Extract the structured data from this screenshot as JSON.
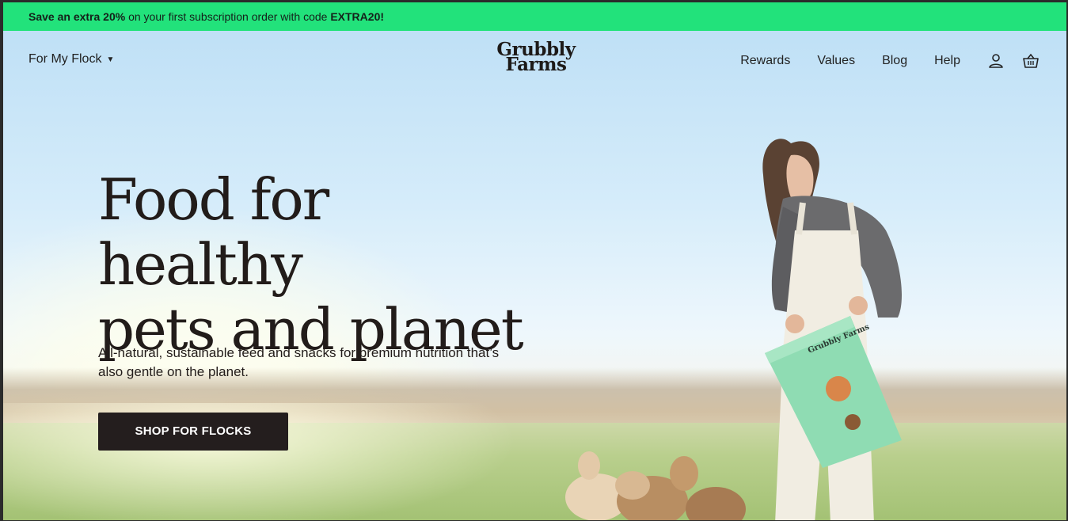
{
  "promo": {
    "prefix_bold": "Save an extra 20%",
    "middle": " on your first subscription order with code ",
    "code": "EXTRA20!"
  },
  "nav": {
    "dropdown_label": "For My Flock",
    "logo_line1": "Grubbly",
    "logo_line2": "Farms",
    "links": [
      "Rewards",
      "Values",
      "Blog",
      "Help"
    ],
    "icons": [
      "account-icon",
      "basket-icon"
    ]
  },
  "hero": {
    "headline_line1": "Food for healthy",
    "headline_line2": "pets and planet",
    "subtext": "All-natural, sustainable feed and snacks for premium nutrition that’s also gentle on the planet.",
    "cta_label": "SHOP FOR FLOCKS",
    "bag_logo": "Grubbly Farms"
  },
  "colors": {
    "promo_bg": "#22e27b",
    "cta_bg": "#241e1e",
    "text": "#221c1a"
  }
}
